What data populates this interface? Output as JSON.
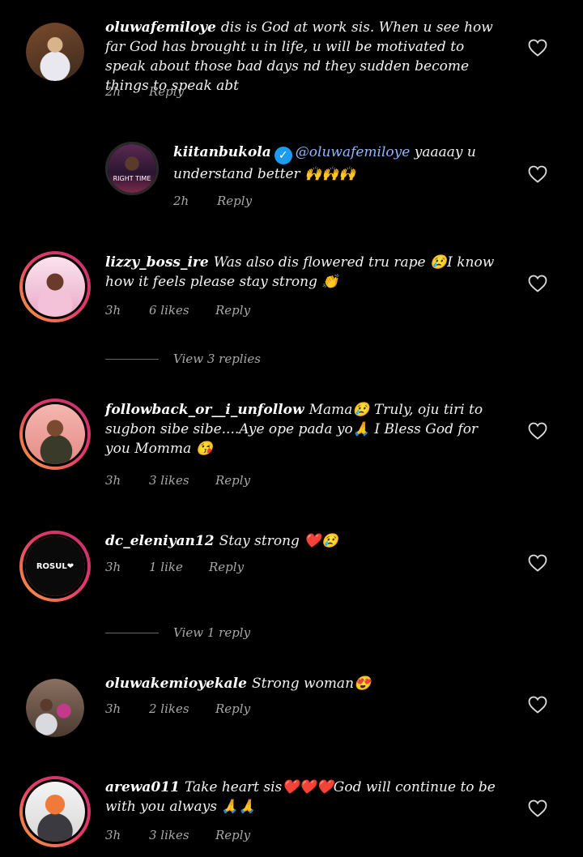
{
  "comments": [
    {
      "username": "oluwafemiloye",
      "text": "dis is God at work sis. When u see how far God has brought u in life, u will be motivated to speak about those bad days nd they sudden become things to speak abt",
      "time": "2h",
      "likes": "",
      "reply_label": "Reply"
    },
    {
      "username": "kiitanbukola",
      "mention": "@oluwafemiloye",
      "text": " yaaaay u understand better 🙌🙌🙌",
      "time": "2h",
      "likes": "",
      "reply_label": "Reply",
      "avatar_caption": "RIGHT TIME"
    },
    {
      "username": "lizzy_boss_ire",
      "text": "Was also dis flowered tru rape 😢I know how it feels please stay strong 👏",
      "time": "3h",
      "likes": "6 likes",
      "reply_label": "Reply"
    },
    {
      "username": "followback_or__i_unfollow",
      "text": "Mama😢 Truly, oju tiri to sugbon sibe sibe....Aye ope pada yo🙏 I Bless God for you Momma 😘",
      "time": "3h",
      "likes": "3 likes",
      "reply_label": "Reply"
    },
    {
      "username": "dc_eleniyan12",
      "text": "Stay strong ❤️😢",
      "time": "3h",
      "likes": "1 like",
      "reply_label": "Reply",
      "avatar_caption": "ROSUL❤"
    },
    {
      "username": "oluwakemioyekale",
      "text": "Strong woman😍",
      "time": "3h",
      "likes": "2 likes",
      "reply_label": "Reply"
    },
    {
      "username": "arewa011",
      "text": "Take heart sis❤️❤️❤️God will continue to be with you always 🙏🙏",
      "time": "3h",
      "likes": "3 likes",
      "reply_label": "Reply"
    }
  ],
  "view_replies": [
    "View 3 replies",
    "View 1 reply"
  ],
  "icons": {
    "like": "heart-outline-icon",
    "verified": "verified-badge-icon"
  },
  "colors": {
    "background": "#000000",
    "text": "#f2f2f2",
    "meta": "#a8a8a8",
    "mention": "#8fb6ff",
    "verified": "#1d9bf0",
    "story_ring_start": "#f9a43a",
    "story_ring_end": "#c1306d"
  }
}
